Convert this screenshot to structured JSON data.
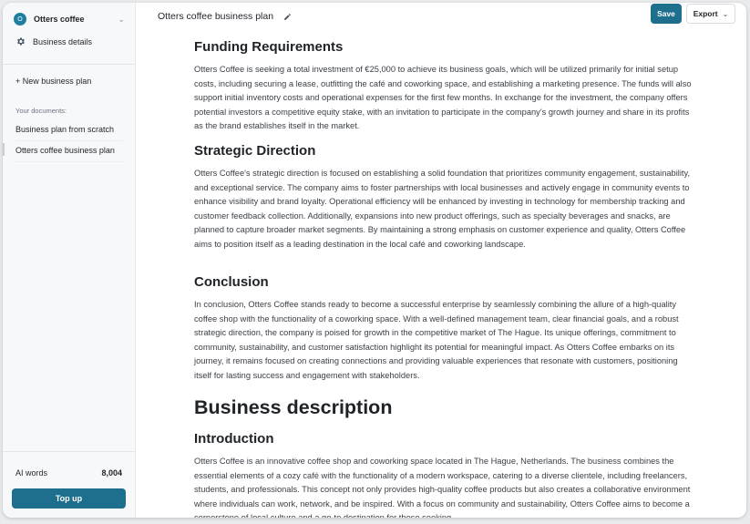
{
  "sidebar": {
    "workspace": {
      "avatar": "O",
      "name": "Otters coffee",
      "chevron_icon": "chevron-down-icon"
    },
    "business_details": {
      "icon": "gear-icon",
      "label": "Business details"
    },
    "new_plan_label": "+ New business plan",
    "documents_label": "Your documents:",
    "documents": [
      {
        "title": "Business plan from scratch",
        "active": false
      },
      {
        "title": "Otters coffee business plan",
        "active": true
      }
    ],
    "ai_words": {
      "label": "AI words",
      "value": "8,004"
    },
    "top_up_label": "Top up"
  },
  "header": {
    "document_title": "Otters coffee business plan",
    "edit_icon": "pencil-icon",
    "save_label": "Save",
    "export_label": "Export"
  },
  "content": {
    "funding_heading": "Funding Requirements",
    "funding_text": "Otters Coffee is seeking a total investment of €25,000 to achieve its business goals, which will be utilized primarily for initial setup costs, including securing a lease, outfitting the café and coworking space, and establishing a marketing presence. The funds will also support initial inventory costs and operational expenses for the first few months. In exchange for the investment, the company offers potential investors a competitive equity stake, with an invitation to participate in the company's growth journey and share in its profits as the brand establishes itself in the market.",
    "strategic_heading": "Strategic Direction",
    "strategic_text": "Otters Coffee's strategic direction is focused on establishing a solid foundation that prioritizes community engagement, sustainability, and exceptional service. The company aims to foster partnerships with local businesses and actively engage in community events to enhance visibility and brand loyalty. Operational efficiency will be enhanced by investing in technology for membership tracking and customer feedback collection. Additionally, expansions into new product offerings, such as specialty beverages and snacks, are planned to capture broader market segments. By maintaining a strong emphasis on customer experience and quality, Otters Coffee aims to position itself as a leading destination in the local café and coworking landscape.",
    "conclusion_heading": "Conclusion",
    "conclusion_text": "In conclusion, Otters Coffee stands ready to become a successful enterprise by seamlessly combining the allure of a high-quality coffee shop with the functionality of a coworking space. With a well-defined management team, clear financial goals, and a robust strategic direction, the company is poised for growth in the competitive market of The Hague. Its unique offerings, commitment to community, sustainability, and customer satisfaction highlight its potential for meaningful impact. As Otters Coffee embarks on its journey, it remains focused on creating connections and providing valuable experiences that resonate with customers, positioning itself for lasting success and engagement with stakeholders.",
    "business_description_heading": "Business description",
    "introduction_heading": "Introduction",
    "introduction_text": "Otters Coffee is an innovative coffee shop and coworking space located in The Hague, Netherlands. The business combines the essential elements of a cozy café with the functionality of a modern workspace, catering to a diverse clientele, including freelancers, students, and professionals. This concept not only provides high-quality coffee products but also creates a collaborative environment where individuals can work, network, and be inspired. With a focus on community and sustainability, Otters Coffee aims to become a cornerstone of local culture and a go-to destination for those seeking"
  },
  "colors": {
    "accent": "#1e6f8d",
    "avatar": "#1e7ea0",
    "sidebar_bg": "#f7f8f9"
  }
}
